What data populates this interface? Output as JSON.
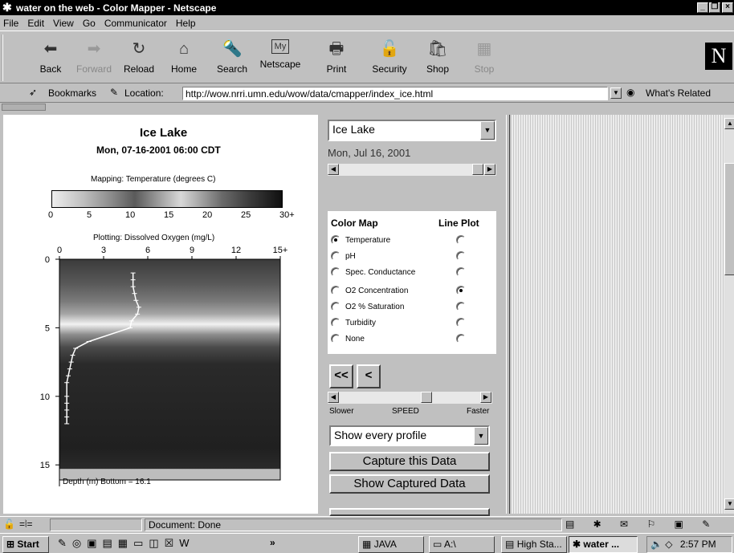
{
  "window": {
    "title": "water on the web - Color Mapper - Netscape"
  },
  "menu": [
    "File",
    "Edit",
    "View",
    "Go",
    "Communicator",
    "Help"
  ],
  "toolbar": [
    {
      "label": "Back",
      "icon": "back-arrow-icon",
      "enabled": true
    },
    {
      "label": "Forward",
      "icon": "forward-arrow-icon",
      "enabled": false
    },
    {
      "label": "Reload",
      "icon": "reload-icon",
      "enabled": true
    },
    {
      "label": "Home",
      "icon": "home-icon",
      "enabled": true
    },
    {
      "label": "Search",
      "icon": "search-icon",
      "enabled": true
    },
    {
      "label": "Netscape",
      "icon": "my-netscape-icon",
      "enabled": true
    },
    {
      "label": "Print",
      "icon": "printer-icon",
      "enabled": true
    },
    {
      "label": "Security",
      "icon": "lock-icon",
      "enabled": true
    },
    {
      "label": "Shop",
      "icon": "shop-icon",
      "enabled": true
    },
    {
      "label": "Stop",
      "icon": "stop-icon",
      "enabled": false
    }
  ],
  "location": {
    "bookmarks_label": "Bookmarks",
    "location_label": "Location:",
    "url": "http://wow.nrri.umn.edu/wow/data/cmapper/index_ice.html",
    "whats_related": "What's Related"
  },
  "plot": {
    "title": "Ice Lake",
    "datetime": "Mon, 07-16-2001 06:00 CDT",
    "mapping_label": "Mapping: Temperature (degrees C)",
    "colorbar_ticks": [
      "0",
      "5",
      "10",
      "15",
      "20",
      "25",
      "30+"
    ],
    "plotting_label": "Plotting: Dissolved Oxygen (mg/L)",
    "x_ticks": [
      "0",
      "3",
      "6",
      "9",
      "12",
      "15+"
    ],
    "y_ticks": [
      "0",
      "5",
      "10",
      "15"
    ],
    "depth_label": "Depth (m)  Bottom = 16.1"
  },
  "chart_data": {
    "type": "line",
    "title": "Ice Lake",
    "xlabel": "Plotting: Dissolved Oxygen (mg/L)",
    "ylabel": "Depth (m)",
    "xlim": [
      0,
      15
    ],
    "ylim": [
      0,
      16.1
    ],
    "series": [
      {
        "name": "Dissolved Oxygen",
        "x": [
          5.0,
          5.0,
          5.0,
          5.1,
          5.2,
          5.4,
          5.3,
          4.9,
          4.8,
          2.0,
          1.1,
          0.9,
          0.8,
          0.7,
          0.6,
          0.5,
          0.5,
          0.5,
          0.5,
          0.5,
          0.5
        ],
        "y": [
          1.0,
          1.5,
          2.0,
          2.5,
          3.0,
          3.5,
          4.0,
          4.5,
          5.0,
          6.0,
          6.5,
          7.0,
          7.5,
          8.0,
          8.5,
          9.0,
          10.0,
          10.5,
          11.0,
          11.5,
          12.0
        ]
      }
    ]
  },
  "controls": {
    "lake_select": "Ice Lake",
    "date_label": "Mon, Jul 16, 2001",
    "color_map_header": "Color Map",
    "line_plot_header": "Line Plot",
    "params": [
      "Temperature",
      "pH",
      "Spec. Conductance",
      "O2 Concentration",
      "O2 % Saturation",
      "Turbidity",
      "None"
    ],
    "colormap_selected": "Temperature",
    "lineplot_selected": "O2 Concentration",
    "rewind_label": "<<",
    "back_label": "<",
    "speed_slower": "Slower",
    "speed_label": "SPEED",
    "speed_faster": "Faster",
    "speed_level": 0.63,
    "profile_select": "Show every profile",
    "capture_button": "Capture this Data",
    "show_captured_button": "Show Captured Data"
  },
  "status": {
    "text": "Document: Done"
  },
  "taskbar": {
    "start": "Start",
    "tasks": [
      "JAVA",
      "A:\\",
      "High Sta...",
      "water ..."
    ],
    "clock": "2:57 PM",
    "more": "»"
  }
}
